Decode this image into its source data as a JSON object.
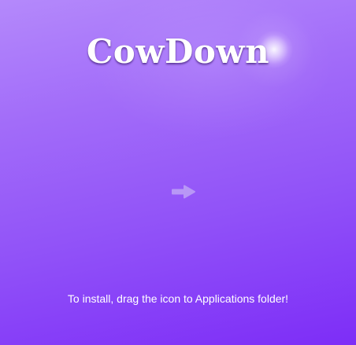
{
  "window": {
    "app_title": "CowDown",
    "instruction": "To install, drag the icon to Applications folder!"
  },
  "icons": {
    "arrow": "arrow-right-icon",
    "flare": "lens-flare"
  },
  "colors": {
    "background_top": "#b489fb",
    "background_bottom": "#7d2df7",
    "text": "#ffffff",
    "arrow": "#b897f6"
  }
}
